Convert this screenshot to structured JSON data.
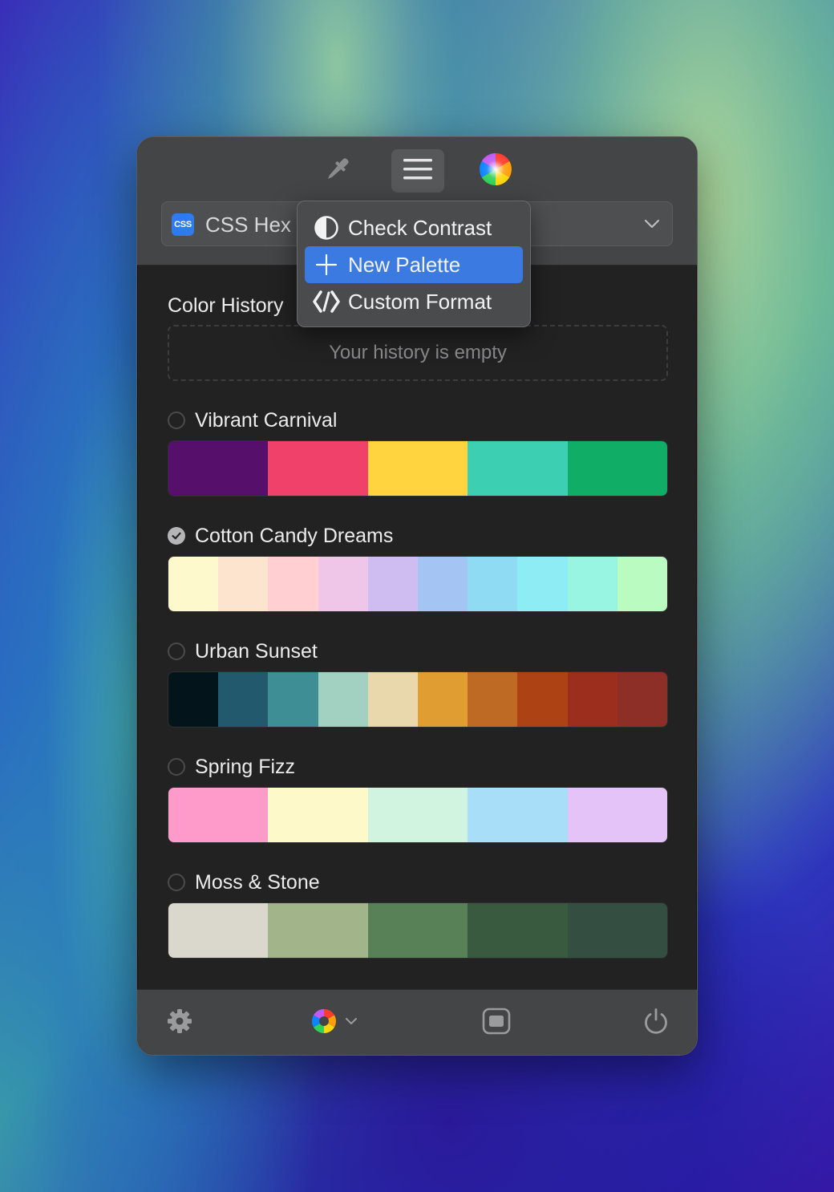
{
  "toolbar": {
    "eyedropper_icon": "eyedropper-icon",
    "menu_icon": "hamburger-icon",
    "color_wheel_icon": "color-wheel-icon"
  },
  "format": {
    "badge": "CSS",
    "label": "CSS Hex"
  },
  "menu": {
    "items": [
      {
        "label": "Check Contrast",
        "icon": "contrast-icon"
      },
      {
        "label": "New Palette",
        "icon": "plus-icon",
        "highlighted": true
      },
      {
        "label": "Custom Format",
        "icon": "code-icon"
      }
    ]
  },
  "history": {
    "title": "Color History",
    "empty_text": "Your history is empty"
  },
  "palettes": [
    {
      "name": "Vibrant Carnival",
      "selected": false,
      "colors": [
        "#560f6a",
        "#ef416a",
        "#ffd43f",
        "#3ccfb1",
        "#0fad66"
      ]
    },
    {
      "name": "Cotton Candy Dreams",
      "selected": true,
      "colors": [
        "#fef8cd",
        "#fde4cf",
        "#ffcfd2",
        "#f0c6e8",
        "#cfbcf0",
        "#a4c4f4",
        "#90dbf4",
        "#8eecf5",
        "#98f5e1",
        "#b9fbc0"
      ]
    },
    {
      "name": "Urban Sunset",
      "selected": false,
      "colors": [
        "#03141a",
        "#23596d",
        "#3e8f95",
        "#a3d1c1",
        "#e8d8ac",
        "#e09e32",
        "#bf6a24",
        "#ad4214",
        "#9b2e1c",
        "#8e2f27"
      ]
    },
    {
      "name": "Spring Fizz",
      "selected": false,
      "colors": [
        "#ff9bcb",
        "#fdf9c8",
        "#d0f4df",
        "#a8def8",
        "#e4c3f9"
      ]
    },
    {
      "name": "Moss & Stone",
      "selected": false,
      "colors": [
        "#dad7cd",
        "#a2b48a",
        "#588157",
        "#3a5a40",
        "#344e41"
      ]
    }
  ],
  "bottom_bar": {
    "settings_icon": "gear-icon",
    "picker_icon": "color-segments-icon",
    "window_icon": "window-icon",
    "power_icon": "power-icon"
  }
}
